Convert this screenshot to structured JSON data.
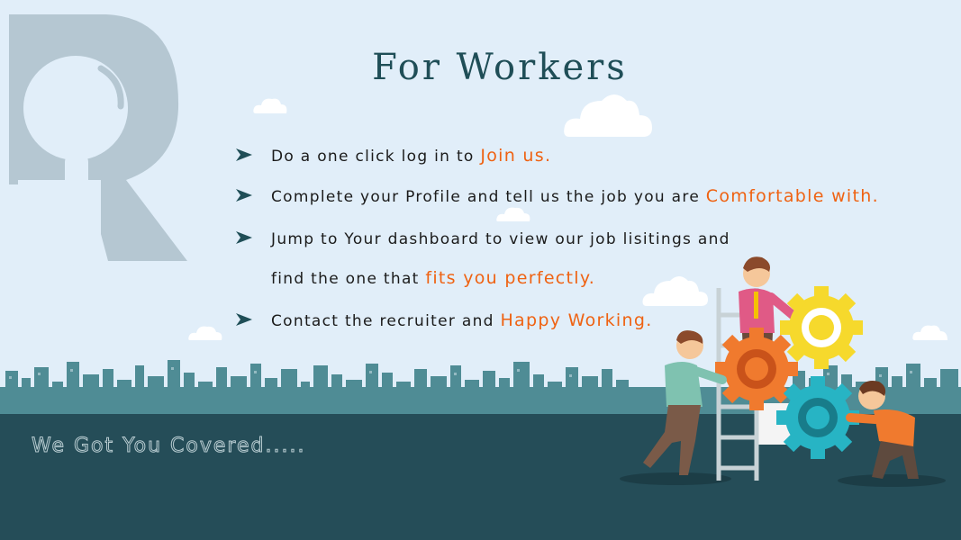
{
  "title": "For Workers",
  "bullets": [
    {
      "text": "Do a one click log in to ",
      "highlight": "Join us."
    },
    {
      "text": "Complete your Profile and tell us the job you are ",
      "highlight": "Comfortable with."
    },
    {
      "text": "Jump to Your dashboard to view our job lisitings and",
      "highlight": ""
    },
    {
      "text": "find the one that ",
      "highlight": "fits you perfectly."
    },
    {
      "text": "Contact the recruiter and ",
      "highlight": "Happy Working."
    }
  ],
  "tagline": "We Got You Covered.....",
  "colors": {
    "sky": "#e1eef9",
    "ground": "#254d58",
    "title": "#1f4e57",
    "highlight": "#ef6212",
    "gear_orange": "#f07a2e",
    "gear_yellow": "#f6d92c",
    "gear_teal": "#27b4c4"
  },
  "icons": [
    "r-magnifier-logo-icon",
    "arrow-bullet-icon",
    "cloud-icon",
    "city-skyline",
    "people-with-gears-illustration"
  ]
}
